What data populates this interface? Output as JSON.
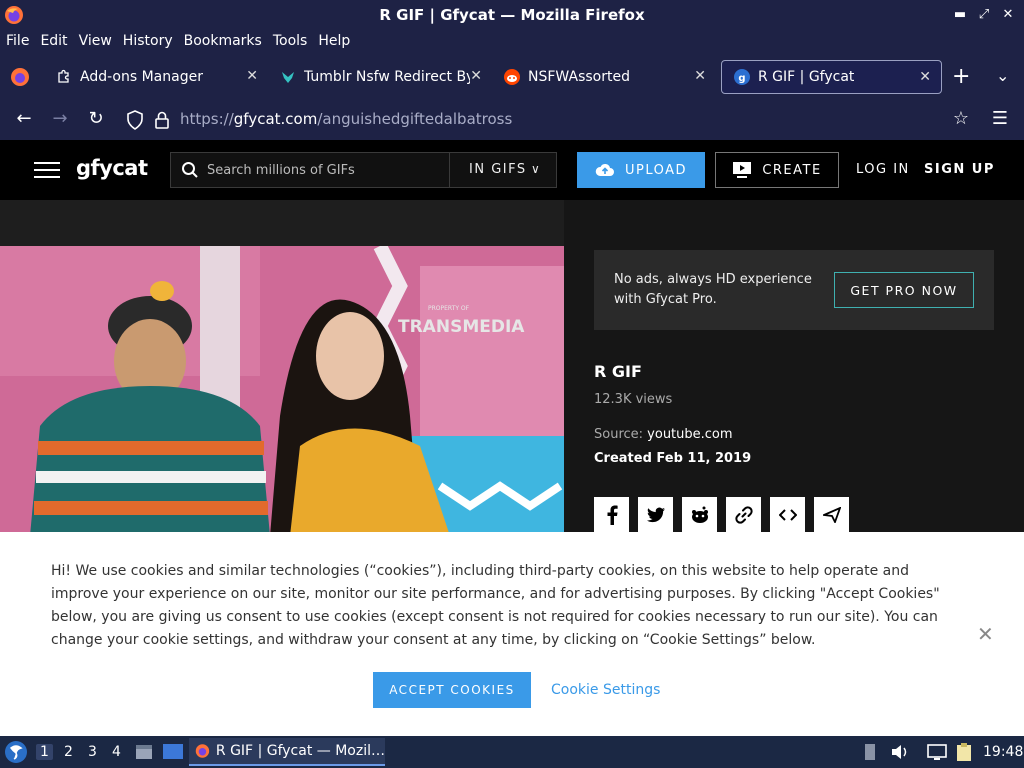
{
  "window": {
    "title": "R GIF | Gfycat — Mozilla Firefox"
  },
  "menu": [
    "File",
    "Edit",
    "View",
    "History",
    "Bookmarks",
    "Tools",
    "Help"
  ],
  "tabs": [
    {
      "label": "Add-ons Manager",
      "icon": "puzzle-icon"
    },
    {
      "label": "Tumblr Nsfw Redirect Byp",
      "icon": "tumblr-extension-icon"
    },
    {
      "label": "NSFWAssorted",
      "icon": "reddit-icon"
    },
    {
      "label": "R GIF | Gfycat",
      "icon": "gfycat-icon",
      "active": true
    }
  ],
  "nav": {
    "url_prefix": "https://",
    "url_host": "gfycat.com",
    "url_path": "/anguishedgiftedalbatross"
  },
  "header": {
    "logo": "gfycat",
    "search_placeholder": "Search millions of GIFs",
    "search_scope": "IN GIFS",
    "upload_label": "UPLOAD",
    "create_label": "CREATE",
    "login_label": "LOG IN",
    "signup_label": "SIGN UP"
  },
  "video": {
    "watermark": "TRANSMEDIA",
    "watermark_small": "PROPERTY OF"
  },
  "sidebar": {
    "promo_text": "No ads, always HD experience with Gfycat Pro.",
    "promo_button": "GET PRO NOW",
    "gif_title": "R GIF",
    "views": "12.3K views",
    "source_label": "Source:",
    "source_value": "youtube.com",
    "created": "Created Feb 11, 2019",
    "share_icons": [
      "facebook-icon",
      "twitter-icon",
      "reddit-icon",
      "link-icon",
      "embed-icon",
      "send-icon"
    ]
  },
  "cookie": {
    "text": "Hi! We use cookies and similar technologies (“cookies”), including third-party cookies, on this website to help operate and improve your experience on our site, monitor our site performance, and for advertising purposes. By clicking \"Accept Cookies\" below, you are giving us consent to use cookies (except consent is not required for cookies necessary to run our site). You can change your cookie settings, and withdraw your consent at any time, by clicking on “Cookie Settings” below.",
    "accept_label": "ACCEPT COOKIES",
    "settings_label": "Cookie Settings",
    "close_glyph": "✕"
  },
  "taskbar": {
    "workspaces": [
      "1",
      "2",
      "3",
      "4"
    ],
    "active_workspace": "1",
    "window_label": "R GIF | Gfycat — Mozil…",
    "clock": "19:48"
  },
  "colors": {
    "chrome_bg": "#1e2245",
    "accent_blue": "#3a9ae8",
    "pro_border": "#3fb0b0",
    "taskbar_bg": "#1b2844"
  }
}
